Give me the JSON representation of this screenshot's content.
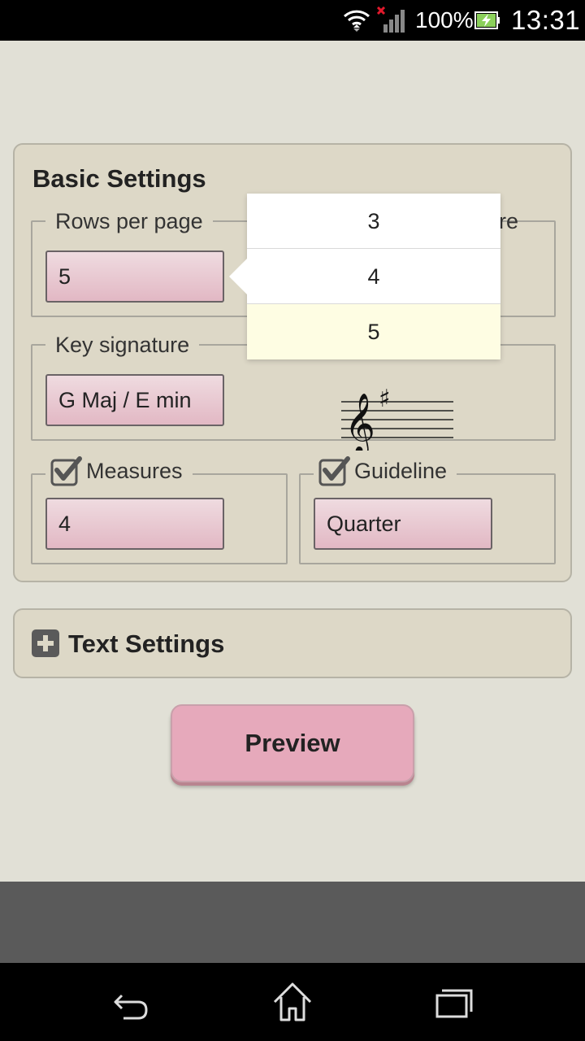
{
  "status_bar": {
    "battery_percent": "100%",
    "time": "13:31"
  },
  "basic_settings": {
    "title": "Basic Settings",
    "rows_per_page": {
      "label": "Rows per page",
      "value": "5"
    },
    "hidden_label_fragment": "re",
    "key_signature": {
      "label": "Key signature",
      "value": "G Maj / E min"
    },
    "measures": {
      "label": "Measures",
      "value": "4",
      "checked": true
    },
    "guideline": {
      "label": "Guideline",
      "value": "Quarter",
      "checked": true
    }
  },
  "dropdown": {
    "options": [
      "3",
      "4",
      "5"
    ],
    "selected": "5"
  },
  "text_settings": {
    "label": "Text Settings"
  },
  "preview_button": {
    "label": "Preview"
  },
  "nav": {
    "icons": [
      "back-icon",
      "home-icon",
      "recent-apps-icon"
    ]
  }
}
